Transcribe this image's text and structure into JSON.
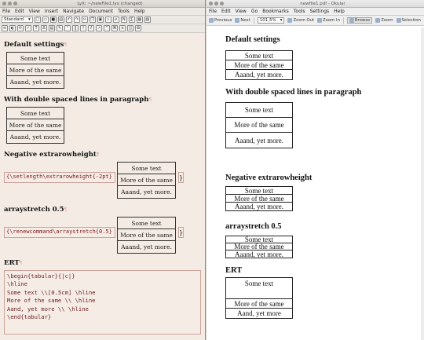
{
  "lyx": {
    "title": "LyX: ~/newFile1.lyx (changed)",
    "menu": [
      "File",
      "Edit",
      "View",
      "Insert",
      "Navigate",
      "Document",
      "Tools",
      "Help"
    ],
    "layout_combo": "Standard",
    "sections": [
      {
        "title": "Default settings"
      },
      {
        "title": "With double spaced lines in paragraph"
      },
      {
        "title": "Negative extrarowheight",
        "ert": "{\\setlength\\extrarowheight{-2pt}",
        "close": "}"
      },
      {
        "title": "arraystretch 0.5",
        "ert": "{\\renewcommand\\arraystretch{0.5}",
        "close": "}"
      },
      {
        "title": "ERT"
      }
    ],
    "table_rows": [
      "Some text",
      "More of the same",
      "Aaand, yet more."
    ],
    "ert_lines": [
      "\\begin{tabular}{|c|}",
      "\\hline",
      "Some text \\\\[0.5cm] \\hline",
      "More of the same \\\\ \\hline",
      "Aand, yet more \\\\ \\hline",
      "\\end{tabular}"
    ]
  },
  "okular": {
    "title": "newfile1.pdf - Okular",
    "menu": [
      "File",
      "Edit",
      "View",
      "Go",
      "Bookmarks",
      "Tools",
      "Settings",
      "Help"
    ],
    "toolbar": {
      "previous": "Previous",
      "next": "Next",
      "zoom_value": "101,5%",
      "zoom_out": "Zoom Out",
      "zoom_in": "Zoom In",
      "browse": "Browse",
      "zoom": "Zoom",
      "selection": "Selection"
    },
    "sections": [
      {
        "title": "Default settings",
        "rows": [
          "Some text",
          "More of the same",
          "Aaand, yet more."
        ]
      },
      {
        "title": "With double spaced lines in paragraph",
        "rows": [
          "Some text",
          "More of the same",
          "Aaand, yet more."
        ]
      },
      {
        "title": "Negative extrarowheight",
        "rows": [
          "Some text",
          "More of the same",
          "Aaand, yet more."
        ]
      },
      {
        "title": "arraystretch 0.5",
        "rows": [
          "Some text",
          "More of the same",
          "Aaand, yet more."
        ]
      },
      {
        "title": "ERT",
        "rows": [
          "Some text",
          "More of the same",
          "Aand, yet more"
        ]
      }
    ]
  }
}
